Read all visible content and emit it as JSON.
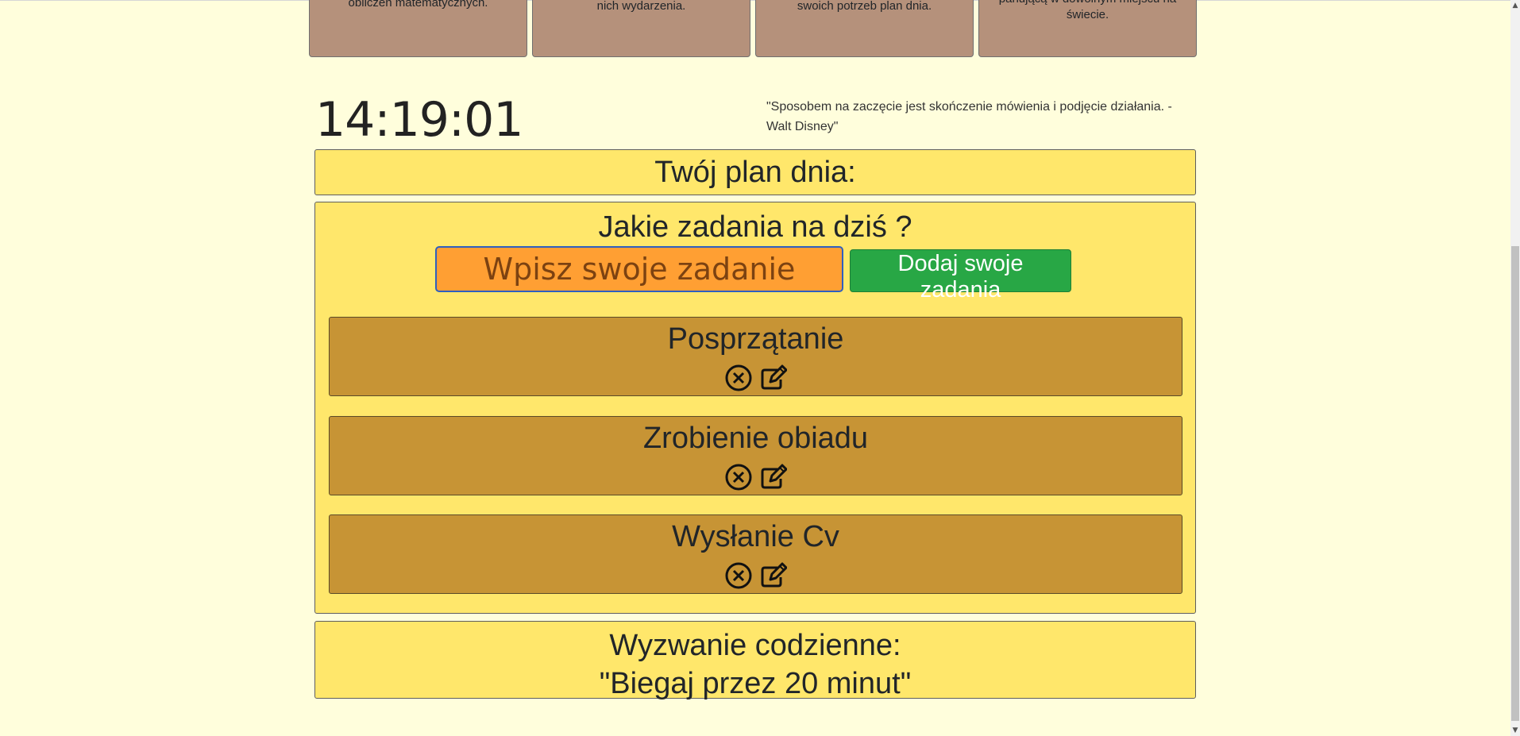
{
  "cards": [
    {
      "text": "obliczeń matematycznych."
    },
    {
      "text": "nich wydarzenia."
    },
    {
      "text": "swoich potrzeb plan dnia."
    },
    {
      "text": "panującą w dowolnym miejscu na świecie."
    }
  ],
  "clock": {
    "time": "14:19:01"
  },
  "quote": {
    "text": "\"Sposobem na zaczęcie jest skończenie mówienia i podjęcie działania. - Walt Disney\""
  },
  "plan": {
    "title": "Twój plan dnia:"
  },
  "tasks": {
    "heading": "Jakie zadania na dziś ?",
    "input_placeholder": "Wpisz swoje zadanie",
    "input_value": "",
    "add_button_label": "Dodaj swoje zadania",
    "items": [
      {
        "label": "Posprzątanie"
      },
      {
        "label": "Zrobienie obiadu"
      },
      {
        "label": "Wysłanie Cv"
      }
    ]
  },
  "challenge": {
    "title": "Wyzwanie codzienne:",
    "text": "\"Biegaj przez 20 minut\""
  },
  "colors": {
    "background": "#fffedc",
    "panel": "#ffe76b",
    "task": "#c79435",
    "input": "#ff9f33",
    "button": "#28a745",
    "card": "#b5917b"
  },
  "icons": [
    "close-circle-icon",
    "edit-icon"
  ]
}
